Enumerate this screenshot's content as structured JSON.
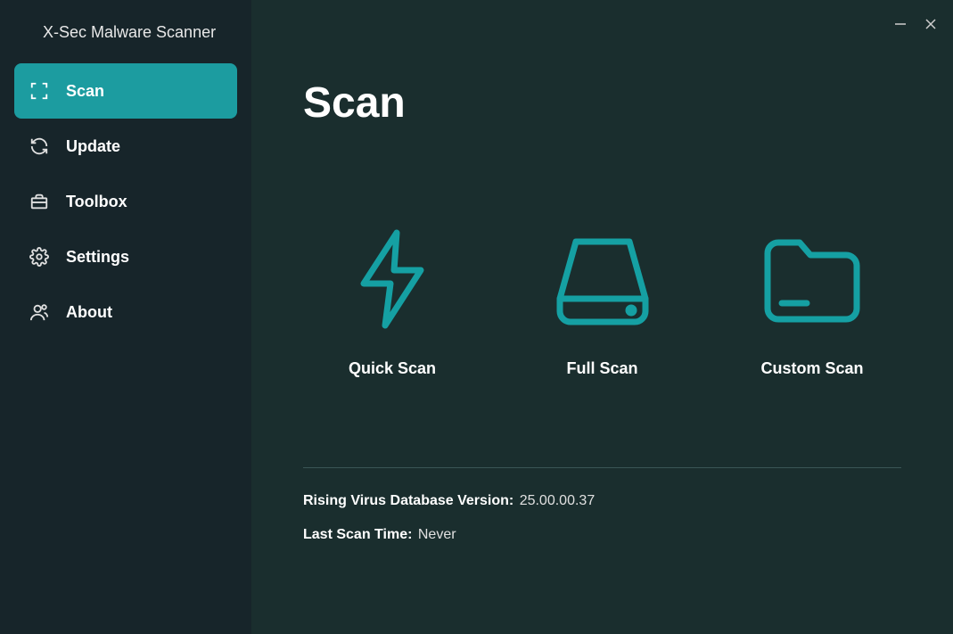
{
  "app_title": "X-Sec Malware Scanner",
  "sidebar": {
    "items": [
      {
        "label": "Scan",
        "icon": "scan-target-icon",
        "active": true
      },
      {
        "label": "Update",
        "icon": "sync-icon",
        "active": false
      },
      {
        "label": "Toolbox",
        "icon": "toolbox-icon",
        "active": false
      },
      {
        "label": "Settings",
        "icon": "gear-icon",
        "active": false
      },
      {
        "label": "About",
        "icon": "person-icon",
        "active": false
      }
    ]
  },
  "main": {
    "page_title": "Scan",
    "scan_options": [
      {
        "label": "Quick Scan",
        "icon": "lightning-icon"
      },
      {
        "label": "Full Scan",
        "icon": "drive-icon"
      },
      {
        "label": "Custom Scan",
        "icon": "folder-icon"
      }
    ],
    "info": {
      "db_label": "Rising Virus Database Version:",
      "db_value": "25.00.00.37",
      "last_scan_label": "Last Scan Time:",
      "last_scan_value": "Never"
    }
  },
  "colors": {
    "accent": "#1c9ca0",
    "icon_stroke": "#15a0a3"
  }
}
